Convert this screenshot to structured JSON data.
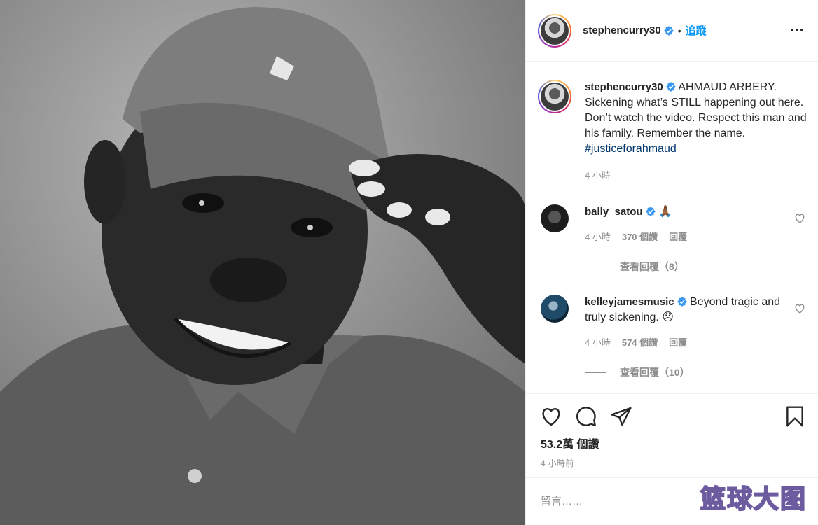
{
  "post": {
    "username": "stephencurry30",
    "dot": "•",
    "follow_label": "追蹤",
    "caption_text": " AHMAUD ARBERY. Sickening what’s STILL happening out here. Don’t watch the video. Respect this man and his family. Remember the name. ",
    "hashtag": "#justiceforahmaud",
    "caption_time": "4 小時"
  },
  "comments": [
    {
      "username": "bally_satou",
      "text": " 🙏🏾",
      "time": "4 小時",
      "likes": "370 個讚",
      "reply_label": "回覆",
      "view_replies": "查看回覆（8）"
    },
    {
      "username": "kelleyjamesmusic",
      "text": " Beyond tragic and truly sickening. 😞",
      "time": "4 小時",
      "likes": "574 個讚",
      "reply_label": "回覆",
      "view_replies": "查看回覆（10）"
    }
  ],
  "stats": {
    "views": "53.2萬 個讚",
    "time_ago": "4 小時前"
  },
  "comment_input": {
    "placeholder": "留言……"
  },
  "watermark": "篮球大图",
  "icons": {
    "more": "more-horizontal-icon",
    "heart": "heart-icon",
    "comment": "comment-icon",
    "share": "share-icon",
    "bookmark": "bookmark-icon",
    "verified": "verified-badge-icon"
  },
  "colors": {
    "link": "#0095f6",
    "hashtag": "#00376b",
    "muted": "#8e8e8e",
    "text": "#262626"
  }
}
